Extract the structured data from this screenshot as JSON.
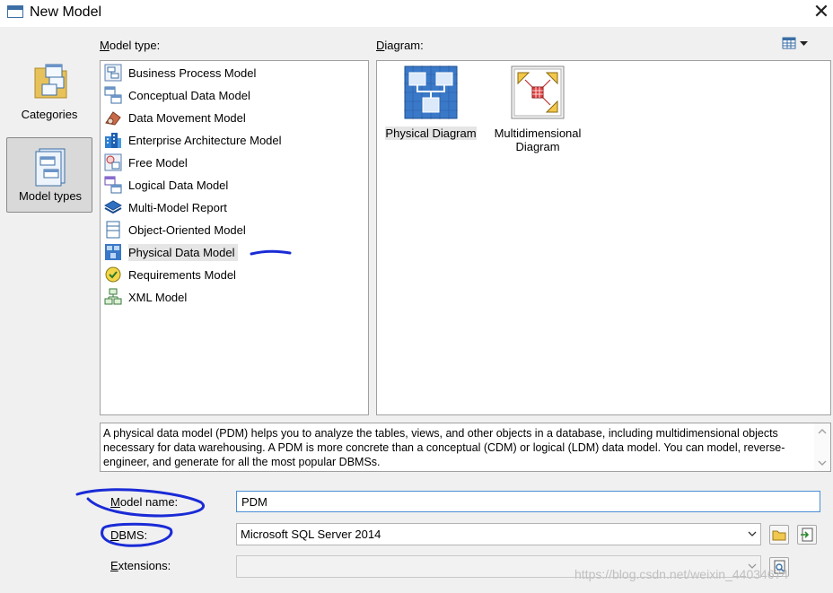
{
  "window": {
    "title": "New Model"
  },
  "categories": [
    {
      "label": "Categories",
      "selected": false
    },
    {
      "label": "Model types",
      "selected": true
    }
  ],
  "model_type": {
    "label_underline": "M",
    "label_rest": "odel type:",
    "items": [
      {
        "label": "Business Process Model",
        "icon": "business-process-model-icon"
      },
      {
        "label": "Conceptual Data Model",
        "icon": "conceptual-data-model-icon"
      },
      {
        "label": "Data Movement Model",
        "icon": "data-movement-model-icon"
      },
      {
        "label": "Enterprise Architecture Model",
        "icon": "enterprise-architecture-model-icon"
      },
      {
        "label": "Free Model",
        "icon": "free-model-icon"
      },
      {
        "label": "Logical Data Model",
        "icon": "logical-data-model-icon"
      },
      {
        "label": "Multi-Model Report",
        "icon": "multi-model-report-icon"
      },
      {
        "label": "Object-Oriented Model",
        "icon": "object-oriented-model-icon"
      },
      {
        "label": "Physical Data Model",
        "icon": "physical-data-model-icon",
        "selected": true
      },
      {
        "label": "Requirements Model",
        "icon": "requirements-model-icon"
      },
      {
        "label": "XML Model",
        "icon": "xml-model-icon"
      }
    ]
  },
  "diagram": {
    "label_underline": "D",
    "label_rest": "iagram:",
    "items": [
      {
        "label": "Physical Diagram",
        "selected": true,
        "icon": "physical-diagram-icon"
      },
      {
        "label_line1": "Multidimensional",
        "label_line2": "Diagram",
        "icon": "multidimensional-diagram-icon"
      }
    ]
  },
  "description": "A physical data model (PDM) helps you to analyze the tables, views, and other objects in a database, including multidimensional objects necessary for data warehousing. A PDM is more concrete than a conceptual (CDM) or logical (LDM) data model. You can model, reverse-engineer, and generate for all the most popular DBMSs.",
  "form": {
    "model_name": {
      "label_underline": "M",
      "label_rest": "odel name:",
      "value": "PDM"
    },
    "dbms": {
      "label_underline": "D",
      "label_rest": "BMS:",
      "value": "Microsoft SQL Server 2014"
    },
    "extensions": {
      "label_underline": "E",
      "label_rest": "xtensions:",
      "value": ""
    }
  },
  "watermark": "https://blog.csdn.net/weixin_44034674",
  "colors": {
    "annotation": "#1a2bd6",
    "selection": "#e5e5e5",
    "focus_border": "#4a8fd6"
  }
}
